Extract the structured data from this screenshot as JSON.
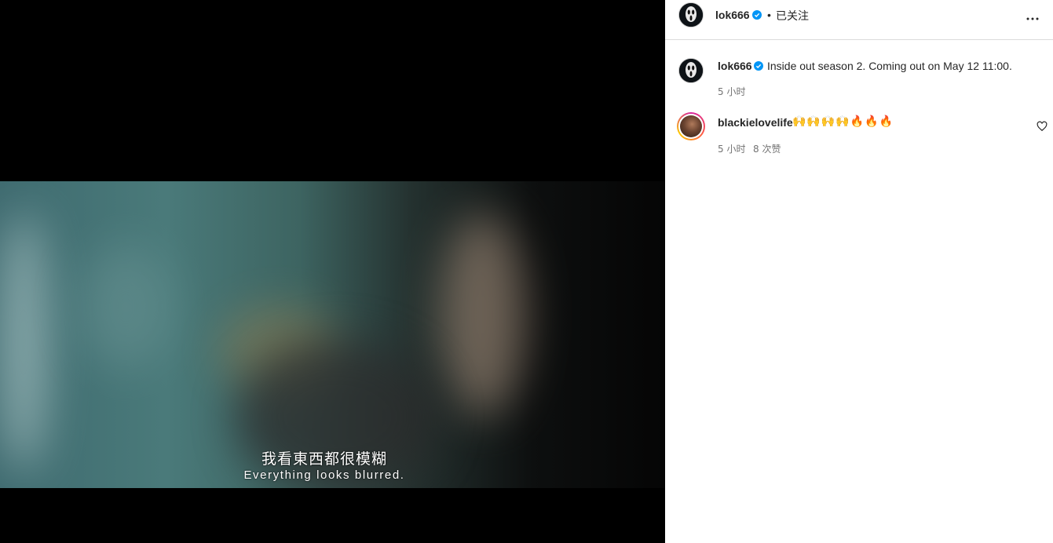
{
  "video": {
    "subtitle_cn": "我看東西都很模糊",
    "subtitle_en": "Everything looks blurred."
  },
  "header": {
    "username": "lok666",
    "separator": "•",
    "follow_status": "已关注",
    "more_icon": "more-horizontal-icon"
  },
  "post": {
    "username": "lok666",
    "caption": "Inside out season 2. Coming out on May 12 11:00.",
    "time": "5 小时"
  },
  "comments": [
    {
      "username": "blackielovelife",
      "text": "🙌🙌🙌🙌🔥🔥🔥",
      "time": "5 小时",
      "likes": "8 次赞"
    }
  ],
  "colors": {
    "verified": "#0095f6",
    "text": "#262626",
    "secondary": "#737373",
    "divider": "#dbdbdb"
  }
}
